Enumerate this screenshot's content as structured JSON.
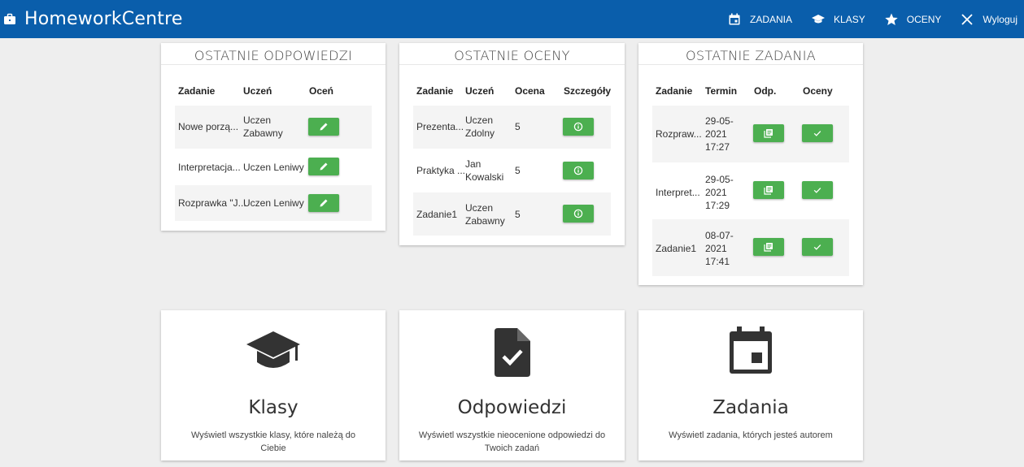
{
  "app": {
    "title": "HomeworkCentre"
  },
  "nav": {
    "zadania": "ZADANIA",
    "klasy": "KLASY",
    "oceny": "OCENY",
    "wyloguj": "Wyloguj"
  },
  "responses": {
    "title": "OSTATNIE ODPOWIEDZI",
    "headers": [
      "Zadanie",
      "Uczeń",
      "Oceń"
    ],
    "rows": [
      {
        "task": "Nowe porzą...",
        "student": "Uczen Zabawny"
      },
      {
        "task": "Interpretacja...",
        "student": "Uczen Leniwy"
      },
      {
        "task": "Rozprawka \"J...",
        "student": "Uczen Leniwy"
      }
    ]
  },
  "grades": {
    "title": "OSTATNIE OCENY",
    "headers": [
      "Zadanie",
      "Uczeń",
      "Ocena",
      "Szczegóły"
    ],
    "rows": [
      {
        "task": "Prezenta...",
        "student": "Uczen Zdolny",
        "grade": "5"
      },
      {
        "task": "Praktyka ...",
        "student": "Jan Kowalski",
        "grade": "5"
      },
      {
        "task": "Zadanie1",
        "student": "Uczen Zabawny",
        "grade": "5"
      }
    ]
  },
  "assignments": {
    "title": "OSTATNIE ZADANIA",
    "headers": [
      "Zadanie",
      "Termin",
      "Odp.",
      "Oceny"
    ],
    "rows": [
      {
        "task": "Rozpraw...",
        "deadline": "29-05-2021 17:27"
      },
      {
        "task": "Interpret...",
        "deadline": "29-05-2021 17:29"
      },
      {
        "task": "Zadanie1",
        "deadline": "08-07-2021 17:41"
      }
    ]
  },
  "tiles": [
    {
      "title": "Klasy",
      "description": "Wyświetl wszystkie klasy, które należą do Ciebie",
      "icon": "graduation-cap-icon"
    },
    {
      "title": "Odpowiedzi",
      "description": "Wyświetl wszystkie nieocenione odpowiedzi do Twoich zadań",
      "icon": "file-check-icon"
    },
    {
      "title": "Zadania",
      "description": "Wyświetl zadania, których jesteś autorem",
      "icon": "calendar-icon"
    }
  ],
  "colors": {
    "primary": "#0a5eab",
    "button": "#4caf50",
    "background": "#eeeeee"
  }
}
